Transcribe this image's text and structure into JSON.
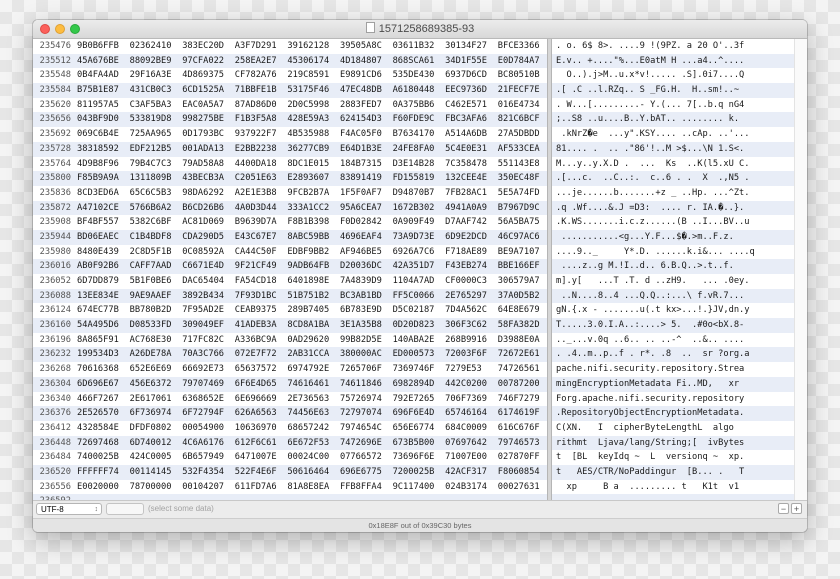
{
  "window": {
    "title": "1571258689385-93"
  },
  "hex_rows": [
    {
      "addr": "235476",
      "cols": [
        "9B0B6FFB",
        "02362410",
        "383EC20D",
        "A3F7D291",
        "39162128",
        "39505A8C",
        "03611B32",
        "30134F27",
        "BFCE3366"
      ]
    },
    {
      "addr": "235512",
      "cols": [
        "45A676BE",
        "88092BE9",
        "97CFA022",
        "258EA2E7",
        "45306174",
        "4D184807",
        "868SCA61",
        "34D1F55E",
        "E0D784A7"
      ]
    },
    {
      "addr": "235548",
      "cols": [
        "0B4FA4AD",
        "29F16A3E",
        "4D869375",
        "CF782A76",
        "219C8591",
        "E9891CD6",
        "535DE430",
        "6937D6CD",
        "BC80510B"
      ]
    },
    {
      "addr": "235584",
      "cols": [
        "B75B1E87",
        "431CB0C3",
        "6CD1525A",
        "71BBFE1B",
        "53175F46",
        "47EC48DB",
        "A6180448",
        "EEC9736D",
        "21FECF7E"
      ]
    },
    {
      "addr": "235620",
      "cols": [
        "811957A5",
        "C3AF5BA3",
        "EAC0A5A7",
        "87AD86D0",
        "2D0C5998",
        "2883FED7",
        "0A375BB6",
        "C462E571",
        "016E4734"
      ]
    },
    {
      "addr": "235656",
      "cols": [
        "043BF9D0",
        "533819D8",
        "998275BE",
        "F1B3F5A8",
        "428E59A3",
        "624154D3",
        "F60FDE9C",
        "FBC3AFA6",
        "821C6BCF"
      ]
    },
    {
      "addr": "235692",
      "cols": [
        "069C6B4E",
        "725AA965",
        "0D1793BC",
        "937922F7",
        "4B535988",
        "F4AC05F0",
        "B7634170",
        "A514A6DB",
        "27A5DBDD"
      ]
    },
    {
      "addr": "235728",
      "cols": [
        "38318592",
        "EDF212B5",
        "001ADA13",
        "E2BB2238",
        "36277CB9",
        "E64D1B3E",
        "24FE8FA0",
        "5C4E0E31",
        "AF533CEA"
      ]
    },
    {
      "addr": "235764",
      "cols": [
        "4D9B8F96",
        "79B4C7C3",
        "79AD58A8",
        "4400DA18",
        "8DC1E015",
        "184B7315",
        "D3E14B28",
        "7C358478",
        "551143E8"
      ]
    },
    {
      "addr": "235800",
      "cols": [
        "F85B9A9A",
        "1311809B",
        "43BECB3A",
        "C2051E63",
        "E2893607",
        "83891419",
        "FD155819",
        "132CEE4E",
        "350EC48F"
      ]
    },
    {
      "addr": "235836",
      "cols": [
        "8CD3ED6A",
        "65C6C5B3",
        "98DA6292",
        "A2E1E3B8",
        "9FCB2B7A",
        "1F5F0AF7",
        "D94870B7",
        "7FB28AC1",
        "5E5A74FD"
      ]
    },
    {
      "addr": "235872",
      "cols": [
        "A47102CE",
        "5766B6A2",
        "B6CD26B6",
        "4A0D3D44",
        "333A1CC2",
        "95A6CEA7",
        "1672B302",
        "4941A0A9",
        "B7967D9C"
      ]
    },
    {
      "addr": "235908",
      "cols": [
        "BF4BF557",
        "5382C6BF",
        "AC81D069",
        "B9639D7A",
        "F8B1B398",
        "F0D02842",
        "0A909F49",
        "D7AAF742",
        "56A5BA75"
      ]
    },
    {
      "addr": "235944",
      "cols": [
        "BD06EAEC",
        "C1B4BDF8",
        "CDA290D5",
        "E43C67E7",
        "8ABC59BB",
        "4696EAF4",
        "73A9D73E",
        "6D9E2DCD",
        "46C97AC6"
      ]
    },
    {
      "addr": "235980",
      "cols": [
        "8480E439",
        "2C8D5F1B",
        "0C08592A",
        "CA44C50F",
        "EDBF9BB2",
        "AF946BE5",
        "6926A7C6",
        "F718AE89",
        "BE9A7107"
      ]
    },
    {
      "addr": "236016",
      "cols": [
        "AB0F92B6",
        "CAFF7AAD",
        "C6671E4D",
        "9F21CF49",
        "9ADB64FB",
        "D20036DC",
        "42A351D7",
        "F43EB274",
        "BBE166EF"
      ]
    },
    {
      "addr": "236052",
      "cols": [
        "6D7DD879",
        "5B1F0BE6",
        "DAC65404",
        "FA54CD18",
        "6401898E",
        "7A4839D9",
        "1104A7AD",
        "CF0000C3",
        "306579A7"
      ]
    },
    {
      "addr": "236088",
      "cols": [
        "13EE834E",
        "9AE9AAEF",
        "3892B434",
        "7F93D1BC",
        "51B751B2",
        "BC3AB1BD",
        "FF5C0066",
        "2E765297",
        "37A0D5B2"
      ]
    },
    {
      "addr": "236124",
      "cols": [
        "674EC77B",
        "BB780B2D",
        "7F95AD2E",
        "CEAB9375",
        "289B7405",
        "6B783E9D",
        "D5C02187",
        "7D4A562C",
        "64E8E679"
      ]
    },
    {
      "addr": "236160",
      "cols": [
        "54A495D6",
        "D08533FD",
        "309049EF",
        "41ADEB3A",
        "8CD8A1BA",
        "3E1A35B8",
        "0D20D823",
        "306F3C62",
        "58FA382D"
      ]
    },
    {
      "addr": "236196",
      "cols": [
        "8A865F91",
        "AC768E30",
        "717FC82C",
        "A336BC9A",
        "0AD29620",
        "99B82D5E",
        "140ABA2E",
        "268B9916",
        "D3988E0A"
      ]
    },
    {
      "addr": "236232",
      "cols": [
        "199534D3",
        "A26DE78A",
        "70A3C766",
        "072E7F72",
        "2AB31CCA",
        "380000AC",
        "ED000573",
        "72003F6F",
        "72672E61"
      ]
    },
    {
      "addr": "236268",
      "cols": [
        "70616368",
        "652E6E69",
        "66692E73",
        "65637572",
        "6974792E",
        "7265706F",
        "7369746F",
        "7279E53",
        "74726561"
      ]
    },
    {
      "addr": "236304",
      "cols": [
        "6D696E67",
        "456E6372",
        "79707469",
        "6F6E4D65",
        "74616461",
        "74611846",
        "6982894D",
        "442C0200",
        "00787200"
      ]
    },
    {
      "addr": "236340",
      "cols": [
        "466F7267",
        "2E617061",
        "6368652E",
        "6E696669",
        "2E736563",
        "75726974",
        "792E7265",
        "706F7369",
        "746F7279"
      ]
    },
    {
      "addr": "236376",
      "cols": [
        "2E526570",
        "6F736974",
        "6F72794F",
        "626A6563",
        "74456E63",
        "72797074",
        "696F6E4D",
        "65746164",
        "6174619F"
      ]
    },
    {
      "addr": "236412",
      "cols": [
        "4328584E",
        "DFDF0802",
        "00054900",
        "10636970",
        "68657242",
        "7974654C",
        "656E6774",
        "684C0009",
        "616C676F"
      ]
    },
    {
      "addr": "236448",
      "cols": [
        "72697468",
        "6D740012",
        "4C6A6176",
        "612F6C61",
        "6E672F53",
        "7472696E",
        "673B5B00",
        "07697642",
        "79746573"
      ]
    },
    {
      "addr": "236484",
      "cols": [
        "7400025B",
        "424C0005",
        "6B657949",
        "6471007E",
        "00024C00",
        "07766572",
        "73696F6E",
        "71007E00",
        "027870FF"
      ]
    },
    {
      "addr": "236520",
      "cols": [
        "FFFFFF74",
        "00114145",
        "532F4354",
        "522F4E6F",
        "50616464",
        "696E6775",
        "7200025B",
        "42ACF317",
        "F8060854"
      ]
    },
    {
      "addr": "236556",
      "cols": [
        "E0020000",
        "78700000",
        "00104207",
        "611FD7A6",
        "81A8E8EA",
        "FFB8FFA4",
        "9C117400",
        "024B3174",
        "00027631"
      ]
    },
    {
      "addr": "236592",
      "cols": [
        "",
        "",
        "",
        "",
        "",
        "",
        "",
        "",
        ""
      ]
    }
  ],
  "text_rows": [
    ". o. 6$ 8>. ....9 !(9PZ. a 20 O'..3f",
    "E.v.. +....\"%...E0atM H ...a4..^....",
    "  O..).j>M..u.x*v!..... .S].0i7....Q",
    ".[ .C ..l.RZq.. S _FG.H.  H..sm!..~",
    ". W...[.........- Y.(... 7[..b.q nG4",
    ";..S8 ..u....B..Y.bAT.. ........ k.",
    " .kNrZ�e  ...y\".KSY.... ..cAp. ..'...",
    "81.... .  .. .\"86'!..M >$...\\N 1.S<.",
    "M...y..y.X.D .  ...  Ks  ..K(l5.xU C.",
    ".[...c.  ..C..:.  c..6 . .  X  .,N5 .",
    "...je......b.......+z _ ..Hp. ...^Zt.",
    ".q .Wf....&.J =D3:  .... r. IA.�..}.",
    ".K.WS.......i.c.z......(B ..I...BV..u",
    " ...........<g...Y.F...$�.>m..F.z.",
    "....9.._     Y*.D. ......k.i&... ....q",
    " ....z..g M.!I..d.. 6.B.Q..>.t..f.",
    "m].y[   ...T .T. d ..zH9.   ... .0ey.",
    " ..N....8..4 ...Q.Q..:...\\ f.vR.7...",
    "gN.{.x - .......u(.t kx>...!.}JV,dn.y",
    "T.....3.0.I.A..:....> 5.  .#0o<bX.8-",
    ".._...v.0q ..6.. .. ..-^  ..&.. ....",
    ". .4..m..p..f . r*. .8  ..  sr ?org.a",
    "pache.nifi.security.repository.Strea",
    "mingEncryptionMetadata Fi..MD,   xr",
    "Forg.apache.nifi.security.repository",
    ".RepositoryObjectEncryptionMetadata.",
    "C(XN.   I  cipherByteLengthL  algo",
    "rithmt  Ljava/lang/String;[  ivBytes",
    "t  [BL  keyIdq ~  L  versionq ~  xp.",
    "t   AES/CTR/NoPaddingur  [B... .   T",
    "  xp     B a  ......... t   K1t  v1",
    ""
  ],
  "footer": {
    "encoding": "UTF-8",
    "hint": "(select some data)",
    "minus": "−",
    "plus": "+"
  },
  "status": "0x18E8F out of 0x39C30 bytes"
}
